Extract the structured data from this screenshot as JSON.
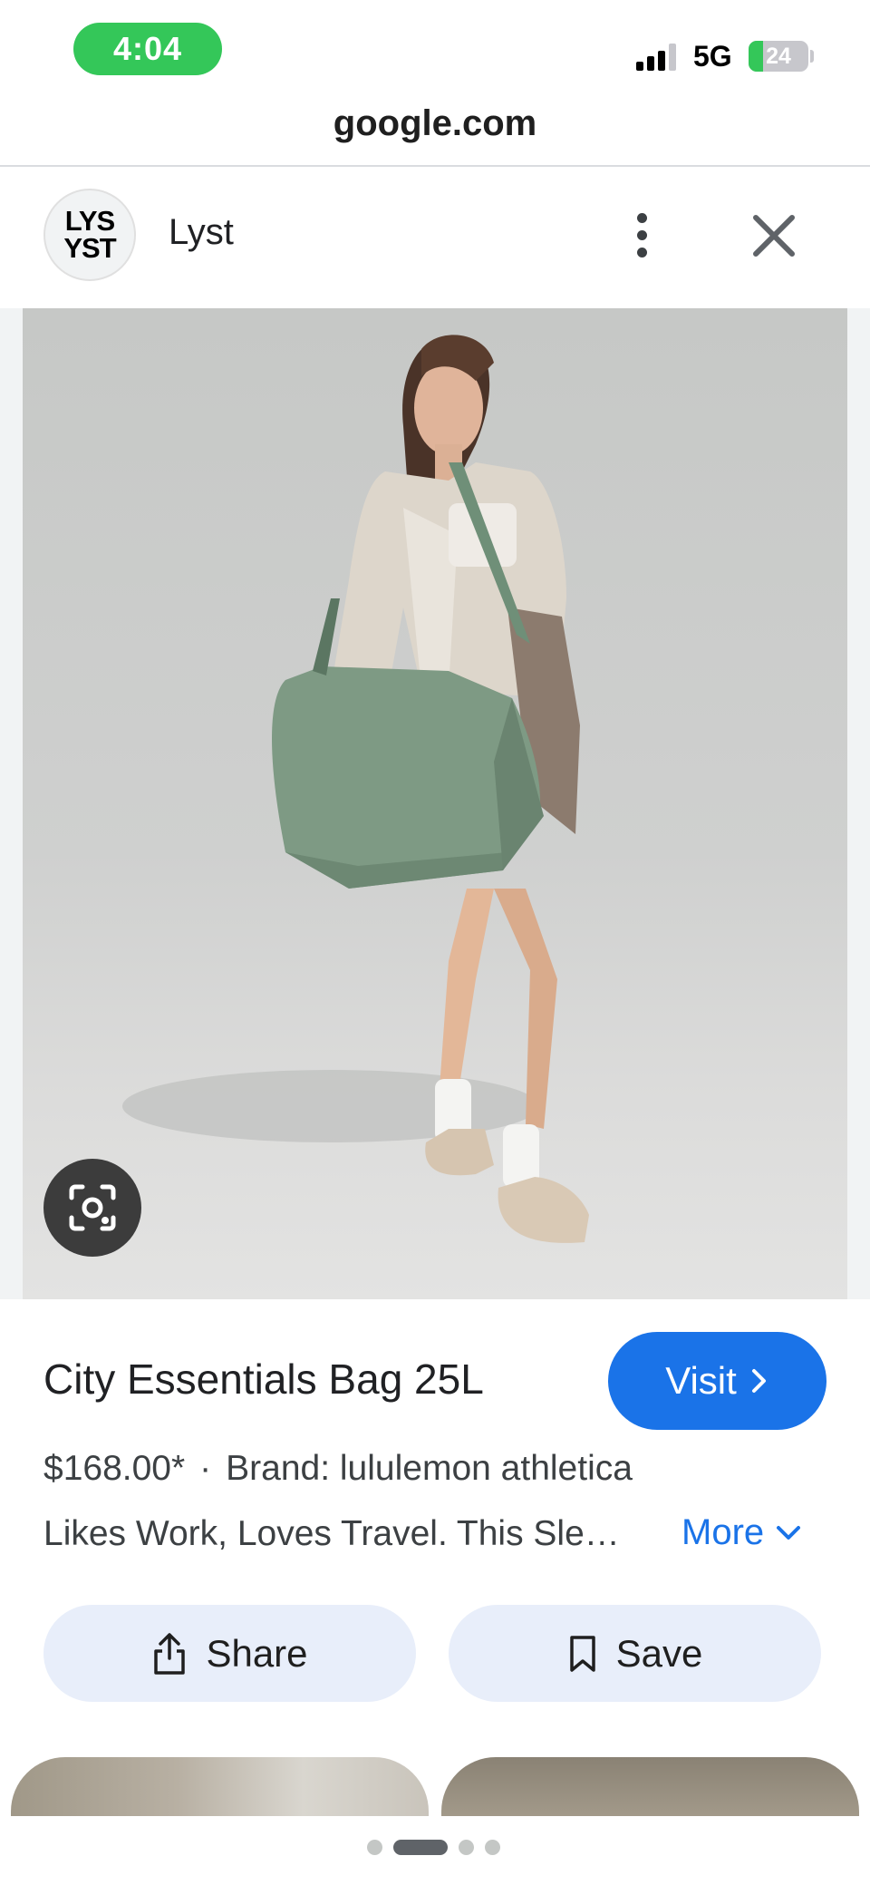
{
  "status_bar": {
    "time": "4:04",
    "network": "5G",
    "battery": "24",
    "battery_level_percent": 24
  },
  "browser": {
    "url": "google.com"
  },
  "source": {
    "logo_text_line1": "LYS",
    "logo_text_line2": "YST",
    "name": "Lyst"
  },
  "icons": {
    "more": "more-vert-icon",
    "close": "close-icon",
    "lens": "google-lens-icon",
    "share": "share-icon",
    "save": "bookmark-icon",
    "visit_chevron": "chevron-right-icon",
    "more_chevron": "chevron-down-icon"
  },
  "product": {
    "title": "City Essentials Bag 25L",
    "visit_label": "Visit",
    "price": "$168.00*",
    "separator": "·",
    "brand": "Brand: lululemon athletica",
    "description": "Likes Work, Loves Travel. This Sle…",
    "more_label": "More"
  },
  "actions": {
    "share_label": "Share",
    "save_label": "Save"
  },
  "colors": {
    "accent": "#1a73e8",
    "pill_bg": "#e8eefa",
    "time_pill": "#34c759"
  },
  "pagination": {
    "total": 4,
    "active_index": 1
  }
}
